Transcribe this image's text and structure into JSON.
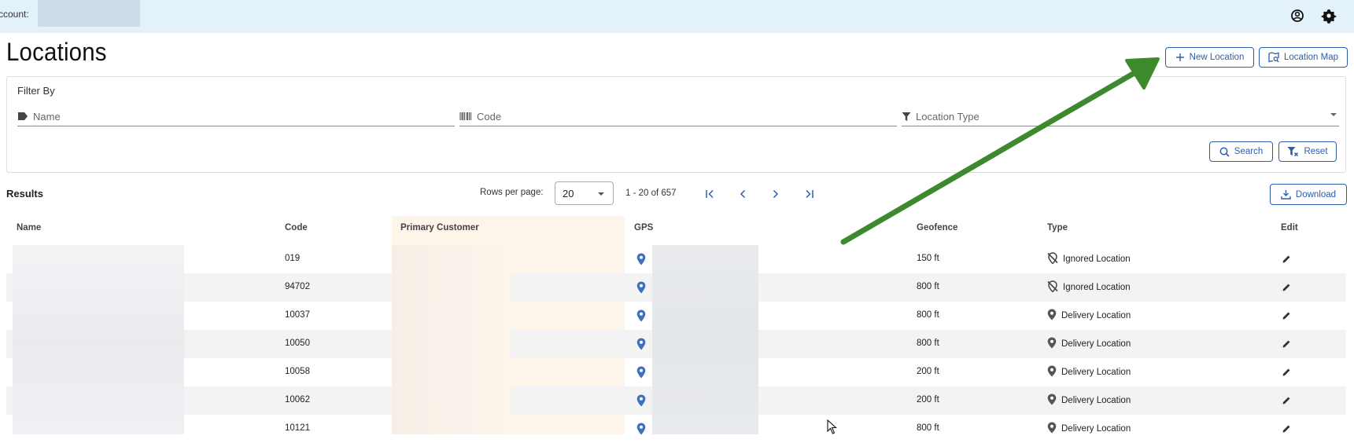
{
  "topbar": {
    "account_label": "ccount:"
  },
  "page": {
    "title": "Locations"
  },
  "actions": {
    "new_location": "New Location",
    "location_map": "Location Map"
  },
  "filter": {
    "title": "Filter By",
    "name_placeholder": "Name",
    "code_placeholder": "Code",
    "type_placeholder": "Location Type",
    "search": "Search",
    "reset": "Reset"
  },
  "results": {
    "label": "Results",
    "rows_per_page_label": "Rows per page:",
    "rows_per_page": "20",
    "range": "1 - 20 of 657",
    "download": "Download"
  },
  "table": {
    "headers": {
      "name": "Name",
      "code": "Code",
      "primary_customer": "Primary Customer",
      "gps": "GPS",
      "geofence": "Geofence",
      "type": "Type",
      "edit": "Edit"
    },
    "rows": [
      {
        "code": "019",
        "geofence": "150 ft",
        "type": "Ignored Location"
      },
      {
        "code": "94702",
        "geofence": "800 ft",
        "type": "Ignored Location"
      },
      {
        "code": "10037",
        "geofence": "800 ft",
        "type": "Delivery Location"
      },
      {
        "code": "10050",
        "geofence": "800 ft",
        "type": "Delivery Location"
      },
      {
        "code": "10058",
        "geofence": "200 ft",
        "type": "Delivery Location"
      },
      {
        "code": "10062",
        "geofence": "200 ft",
        "type": "Delivery Location"
      },
      {
        "code": "10121",
        "geofence": "800 ft",
        "type": "Delivery Location"
      }
    ]
  },
  "colors": {
    "accent": "#2f5ea8",
    "topbar": "#e2f1fa",
    "annotation_arrow": "#3d8a2e",
    "gps_pin": "#3f6fc0"
  },
  "icons": [
    "account-circle-icon",
    "settings-gear-icon",
    "plus-icon",
    "map-search-icon",
    "label-tag-icon",
    "barcode-icon",
    "filter-funnel-icon",
    "search-icon",
    "filter-reset-icon",
    "download-icon",
    "first-page-icon",
    "previous-page-icon",
    "next-page-icon",
    "last-page-icon",
    "map-pin-icon",
    "ignored-location-icon",
    "delivery-location-icon",
    "edit-pencil-icon"
  ]
}
